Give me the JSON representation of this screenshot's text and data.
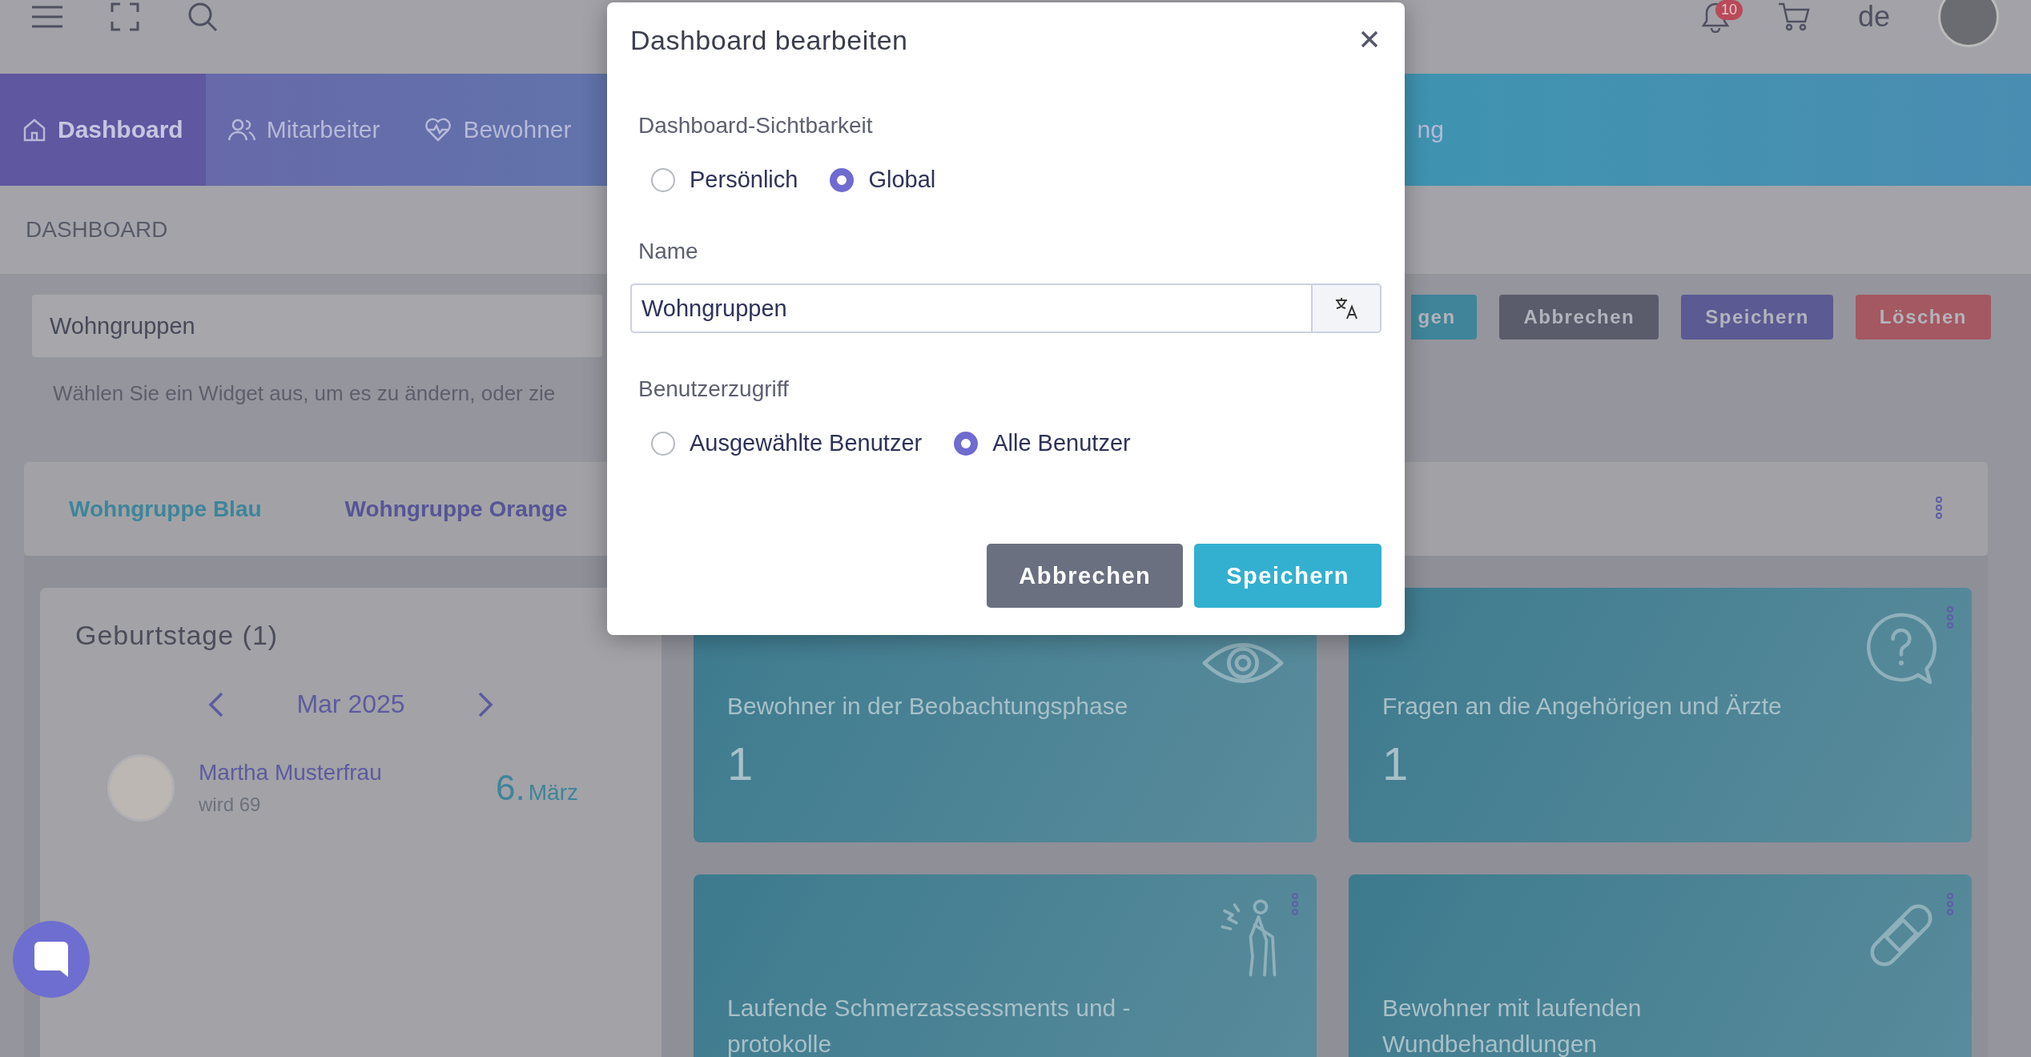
{
  "topbar": {
    "badge": "10",
    "language": "de"
  },
  "nav": [
    {
      "label": "Dashboard",
      "selected": true
    },
    {
      "label": "Mitarbeiter",
      "selected": false
    },
    {
      "label": "Bewohner",
      "selected": false
    },
    {
      "label": "ng",
      "selected": false
    }
  ],
  "breadcrumb": "DASHBOARD",
  "dashboard_name": {
    "value": "Wohngruppen"
  },
  "actions": [
    {
      "label": "gen",
      "kind": "info"
    },
    {
      "label": "Abbrechen",
      "kind": "secondary"
    },
    {
      "label": "Speichern",
      "kind": "primary"
    },
    {
      "label": "Löschen",
      "kind": "danger"
    }
  ],
  "hint": "Wählen Sie ein Widget aus, um es zu ändern, oder zie",
  "group_tabs": [
    {
      "label": "Wohngruppe Blau",
      "selected": true
    },
    {
      "label": "Wohngruppe Orange",
      "selected": false
    }
  ],
  "birthdays": {
    "title": "Geburtstage (1)",
    "month": "Mar 2025",
    "entries": [
      {
        "name": "Martha Musterfrau",
        "age": "wird 69",
        "day": "6.",
        "month": "März"
      }
    ]
  },
  "widgets": [
    {
      "title": "Bewohner in der Beobachtungsphase",
      "count": "1",
      "kind": "eye",
      "has_menu": false
    },
    {
      "title": "Fragen an die Angehörigen und Ärzte",
      "count": "1",
      "kind": "question",
      "has_menu": true
    },
    {
      "title": "Laufende Schmerzassessments und - protokolle",
      "kind": "pain",
      "has_menu": true
    },
    {
      "title": "Bewohner mit laufenden Wundbehandlungen",
      "kind": "bandage",
      "has_menu": true
    }
  ],
  "modal": {
    "title": "Dashboard bearbeiten",
    "visibility": {
      "label": "Dashboard-Sichtbarkeit",
      "options": [
        {
          "label": "Persönlich",
          "selected": false
        },
        {
          "label": "Global",
          "selected": true
        }
      ]
    },
    "name": {
      "label": "Name",
      "value": "Wohngruppen"
    },
    "access": {
      "label": "Benutzerzugriff",
      "options": [
        {
          "label": "Ausgewählte Benutzer",
          "selected": false
        },
        {
          "label": "Alle Benutzer",
          "selected": true
        }
      ]
    },
    "buttons": [
      {
        "label": "Abbrechen",
        "kind": "secondary"
      },
      {
        "label": "Speichern",
        "kind": "primary"
      }
    ]
  }
}
